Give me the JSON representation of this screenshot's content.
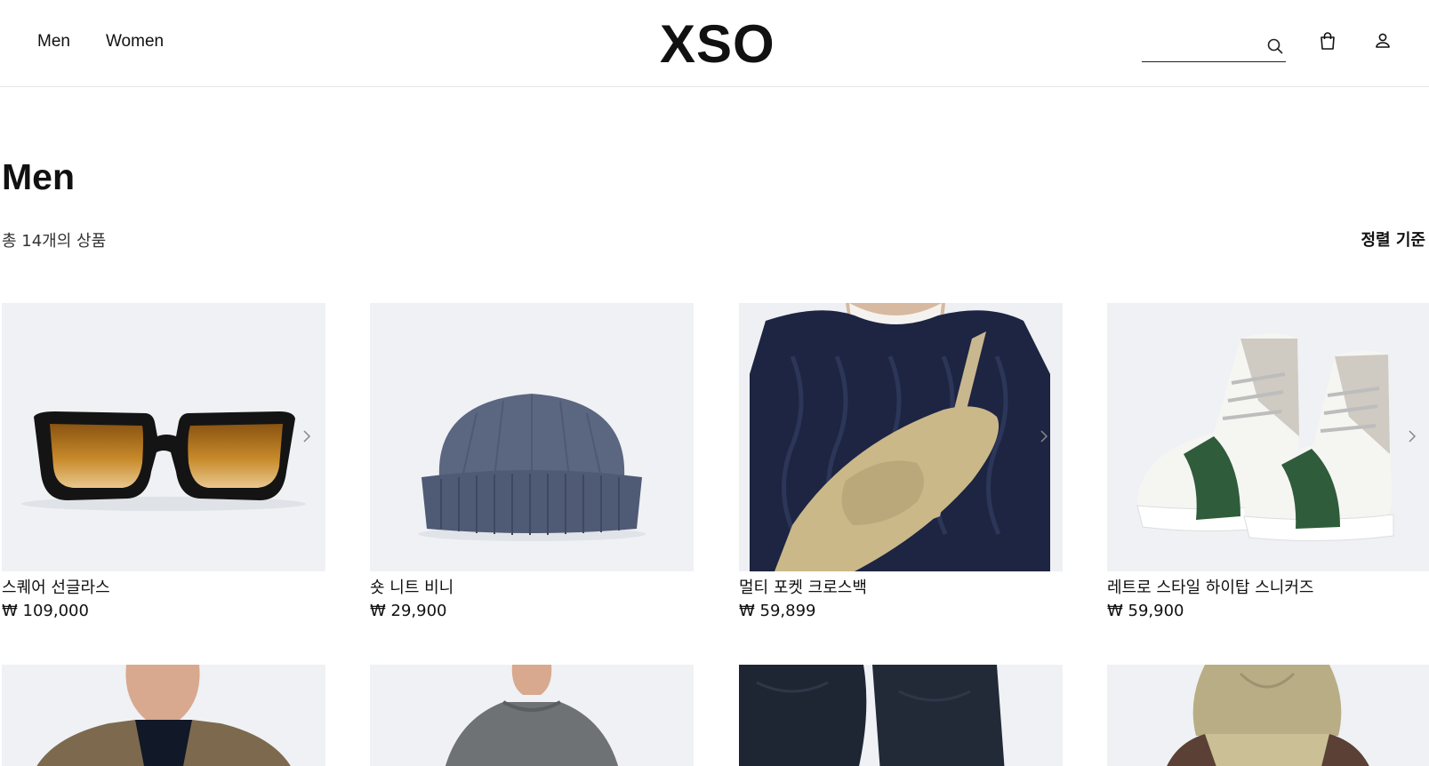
{
  "header": {
    "nav": [
      "Men",
      "Women"
    ],
    "logo": "XSO",
    "search": {
      "placeholder": "",
      "value": ""
    },
    "icons": [
      "search-icon",
      "bag-icon",
      "user-icon"
    ]
  },
  "page": {
    "title": "Men",
    "count": "총 14개의 상품",
    "sort": "정렬 기준"
  },
  "products": [
    {
      "name": "스퀘어 선글라스",
      "price": "₩ 109,000",
      "image": "sunglasses"
    },
    {
      "name": "숏 니트 비니",
      "price": "₩ 29,900",
      "image": "beanie"
    },
    {
      "name": "멀티 포켓 크로스백",
      "price": "₩ 59,899",
      "image": "crossbag"
    },
    {
      "name": "레트로 스타일 하이탑 스니커즈",
      "price": "₩ 59,900",
      "image": "sneakers"
    }
  ],
  "row2_images": [
    "blazer-model",
    "sweater-model",
    "jeans",
    "hoodie"
  ],
  "colors": {
    "image_bg": "#eff1f4",
    "text": "#111111",
    "divider": "#e6e6e6"
  }
}
